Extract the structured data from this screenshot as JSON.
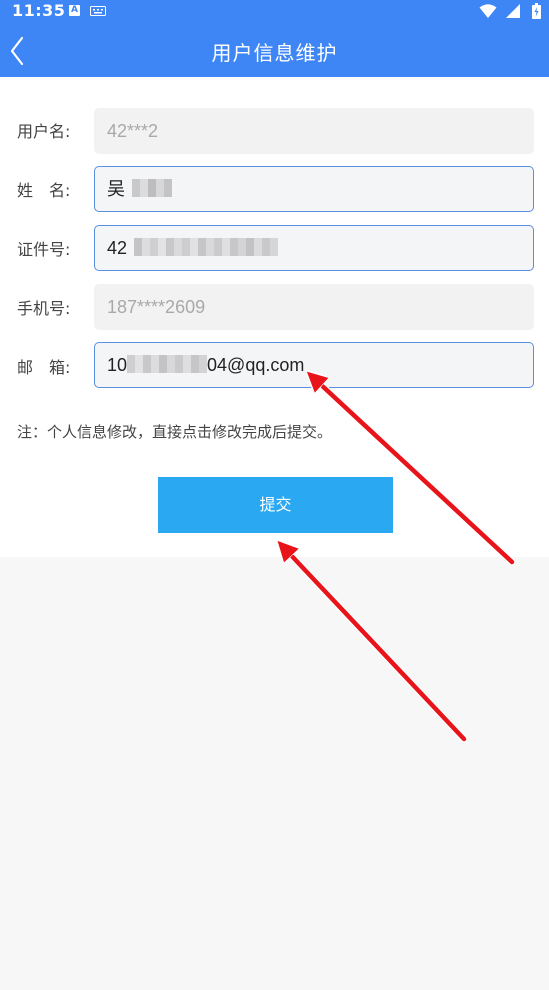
{
  "status_bar": {
    "time": "11:35",
    "notification_icon": "A",
    "icons": [
      "a-notification-icon",
      "keyboard-icon",
      "wifi-icon",
      "signal-icon",
      "battery-icon"
    ]
  },
  "header": {
    "title": "用户信息维护",
    "back_icon": "chevron-left-icon"
  },
  "form": {
    "fields": [
      {
        "label": "用户名:",
        "value": "42***2",
        "editable": false
      },
      {
        "label": "姓　名:",
        "value": "吴",
        "editable": true
      },
      {
        "label": "证件号:",
        "value": "42",
        "editable": true
      },
      {
        "label": "手机号:",
        "value": "187****2609",
        "editable": false
      },
      {
        "label": "邮　箱:",
        "value_prefix": "10",
        "value_suffix": "04@qq.com",
        "editable": true
      }
    ],
    "note": "注：个人信息修改，直接点击修改完成后提交。",
    "submit_label": "提交"
  },
  "colors": {
    "header_bg": "#3e86f5",
    "submit_bg": "#2aa8f2",
    "input_border": "#5b8fdf",
    "arrow": "#e8141a"
  }
}
